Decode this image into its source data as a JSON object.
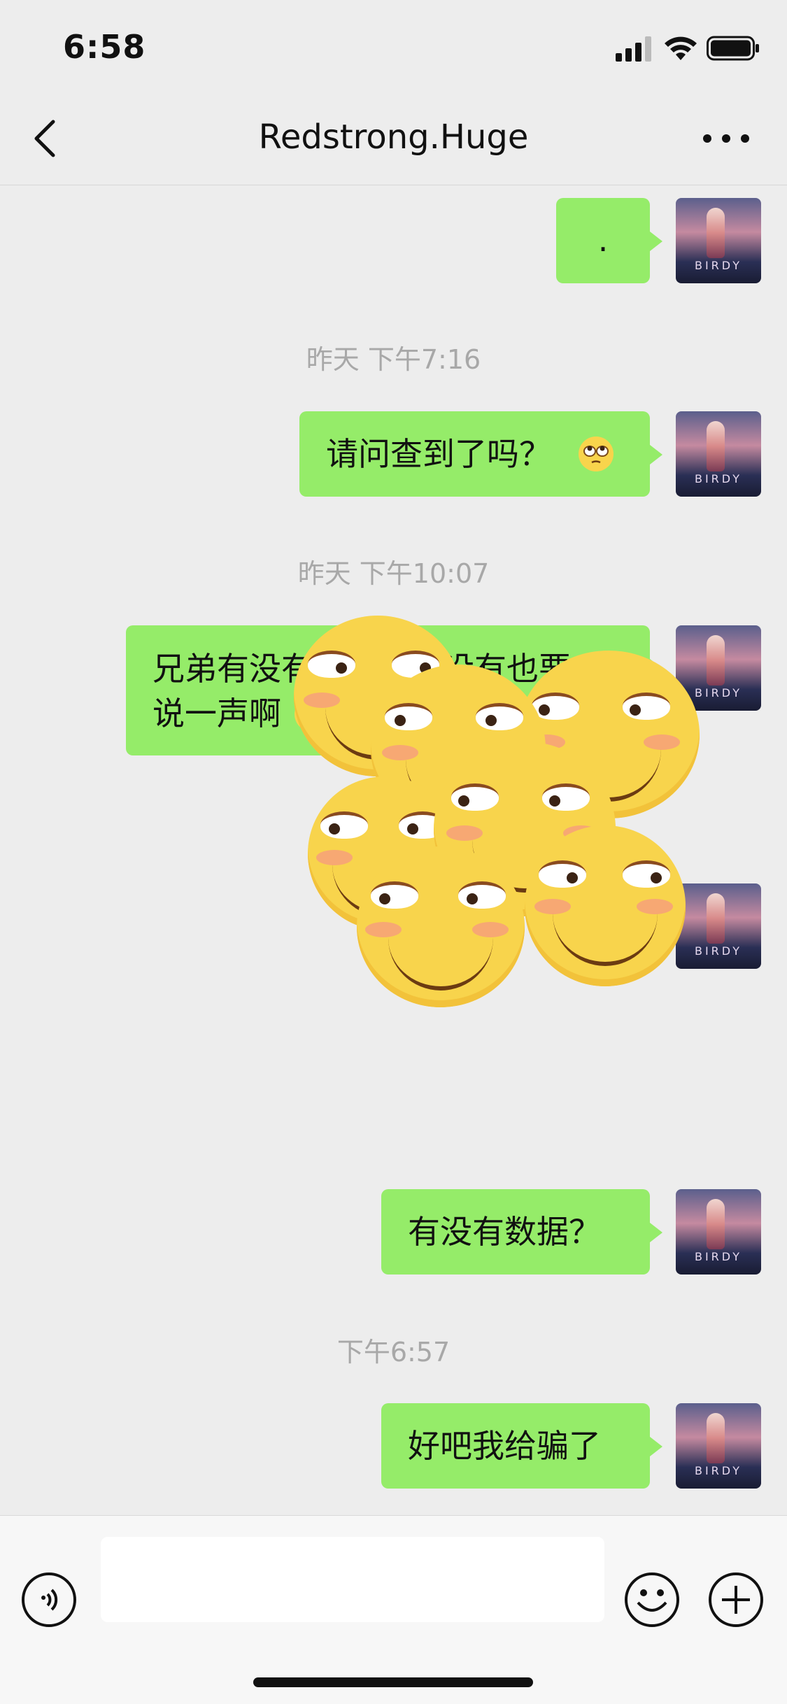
{
  "status_bar": {
    "time": "6:58"
  },
  "nav": {
    "title": "Redstrong.Huge"
  },
  "avatar_label": "BIRDY",
  "messages": [
    {
      "text": "."
    },
    {
      "timestamp": "昨天 下午7:16",
      "text": "请问查到了吗？"
    },
    {
      "timestamp": "昨天 下午10:07",
      "line1": "兄弟有没有数据啊？没有也要",
      "line2": "说一声啊"
    },
    {
      "text": "有没有数据？"
    },
    {
      "timestamp": "下午6:57",
      "text": "好吧我给骗了"
    }
  ],
  "icons": [
    "back-icon",
    "more-icon",
    "voice-icon",
    "emoji-icon",
    "plus-icon",
    "eye-roll-emoji-icon",
    "sleepy-emoji-icon",
    "smirk-sticker-icon"
  ]
}
